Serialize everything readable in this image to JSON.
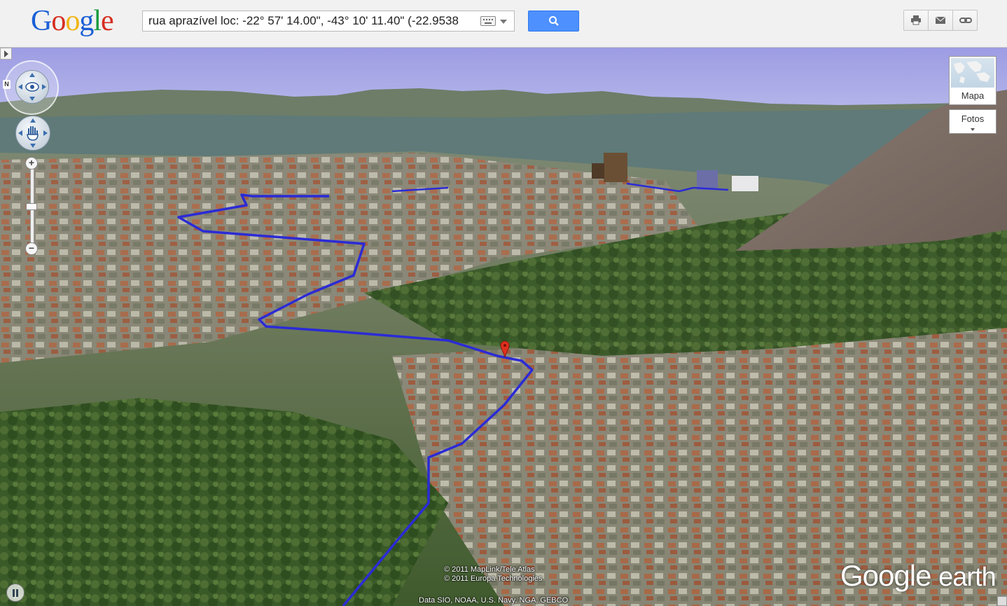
{
  "header": {
    "logo": [
      "G",
      "o",
      "o",
      "g",
      "l",
      "e"
    ],
    "logo_colors": [
      "#1a5fd6",
      "#d62d20",
      "#f1b413",
      "#1a5fd6",
      "#189a3e",
      "#d62d20"
    ],
    "search_value": "rua aprazível loc: -22° 57' 14.00\", -43° 10' 11.40\" (-22.9538",
    "search_button_icon": "search-icon",
    "tools": [
      "print-icon",
      "email-icon",
      "link-icon"
    ]
  },
  "earth": {
    "compass_north": "N",
    "zoom_in": "+",
    "zoom_out": "−",
    "zoom_level": 0.5,
    "map_type_label": "Mapa",
    "photos_label": "Fotos",
    "copyright_lines": [
      "© 2011 MapLink/Tele Atlas",
      "© 2011 Europa Technologies"
    ],
    "data_credit": "Data SIO, NOAA, U.S. Navy, NGA, GEBCO",
    "logo_google": "Google",
    "logo_earth": "earth",
    "colors": {
      "sky": "#a9a9e6",
      "route": "#2b2bd6",
      "marker": "#e0301e",
      "water": "#5f7a78"
    }
  }
}
